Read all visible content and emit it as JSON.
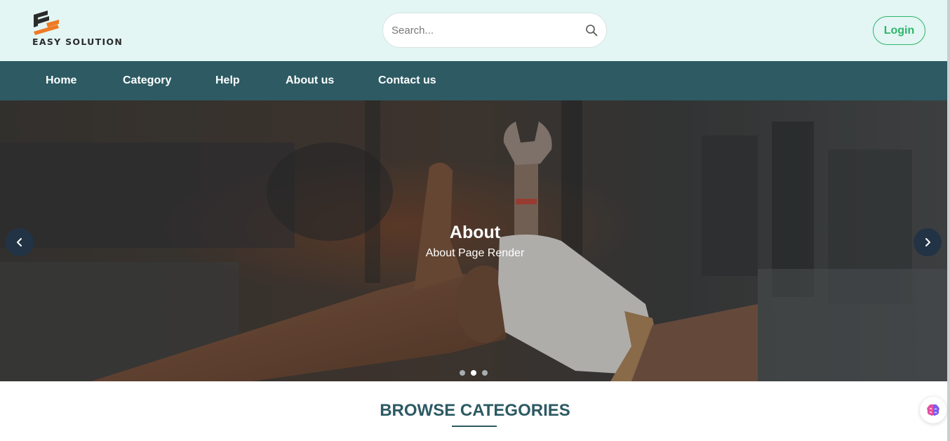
{
  "brand": {
    "name": "EASY SOLUTION",
    "logo_colors": [
      "#2b2b2b",
      "#ee7a23"
    ]
  },
  "search": {
    "placeholder": "Search...",
    "value": "",
    "icon": "search-icon"
  },
  "auth": {
    "login_label": "Login"
  },
  "nav": {
    "items": [
      {
        "label": "Home"
      },
      {
        "label": "Category"
      },
      {
        "label": "Help"
      },
      {
        "label": "About us"
      },
      {
        "label": "Contact us"
      }
    ]
  },
  "hero": {
    "title": "About",
    "subtitle": "About Page Render",
    "prev_icon": "chevron-left-icon",
    "next_icon": "chevron-right-icon",
    "slides_count": 3,
    "active_slide": 2
  },
  "browse": {
    "title": "BROWSE CATEGORIES"
  },
  "colors": {
    "header_bg": "#e3f6f4",
    "nav_bg": "#2d5a63",
    "accent_green": "#2fb56a",
    "title_color": "#2d5a63"
  },
  "widget": {
    "icon": "brain-icon"
  }
}
